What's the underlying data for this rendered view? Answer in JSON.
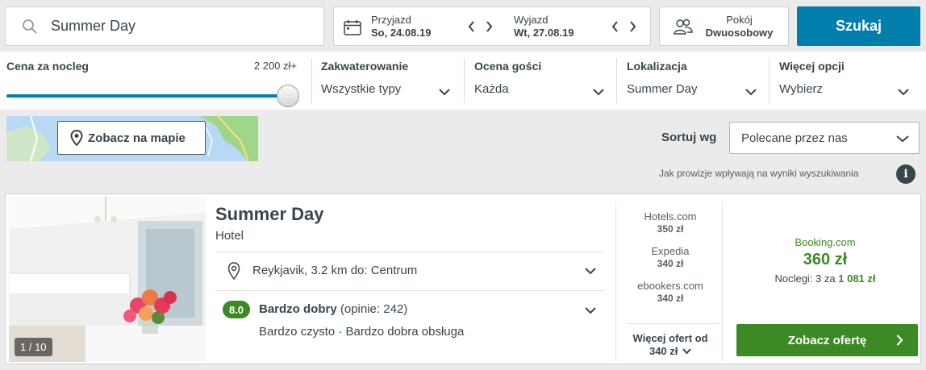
{
  "search": {
    "value": "Summer Day"
  },
  "dates": {
    "checkin_label": "Przyjazd",
    "checkin_date": "So, 24.08.19",
    "checkout_label": "Wyjazd",
    "checkout_date": "Wt, 27.08.19"
  },
  "room": {
    "label": "Pokój",
    "value": "Dwuosobowy"
  },
  "search_button": "Szukaj",
  "filters": {
    "price_title": "Cena za nocleg",
    "price_max": "2 200 zł+",
    "price_slider_fraction": 1.0,
    "accommodation_title": "Zakwaterowanie",
    "accommodation_value": "Wszystkie typy",
    "rating_title": "Ocena gości",
    "rating_value": "Każda",
    "location_title": "Lokalizacja",
    "location_value": "Summer Day",
    "more_title": "Więcej opcji",
    "more_value": "Wybierz"
  },
  "map_button": "Zobacz na mapie",
  "sort": {
    "label": "Sortuj wg",
    "value": "Polecane przez nas"
  },
  "commission_text": "Jak prowizje wpływają na wyniki wyszukiwania",
  "info_icon": "i",
  "hotel": {
    "name": "Summer Day",
    "type": "Hotel",
    "photo_counter": "1 / 10",
    "location": "Reykjavik, 3.2 km do: Centrum",
    "rating_score": "8.0",
    "rating_label": "Bardzo dobry",
    "rating_reviews": "(opinie: 242)",
    "rating_sub": "Bardzo czysto · Bardzo dobra obsługa"
  },
  "offers": [
    {
      "provider": "Hotels.com",
      "price": "350 zł"
    },
    {
      "provider": "Expedia",
      "price": "340 zł"
    },
    {
      "provider": "ebookers.com",
      "price": "340 zł"
    }
  ],
  "more_offers": {
    "line1": "Więcej ofert od",
    "line2": "340 zł"
  },
  "best_offer": {
    "provider": "Booking.com",
    "price": "360 zł",
    "nights_text": "Noclegi: 3 za",
    "total": "1 081 zł",
    "button": "Zobacz ofertę"
  },
  "colors": {
    "primary": "#007fad",
    "green": "#3b8a23",
    "text": "#37454d"
  }
}
